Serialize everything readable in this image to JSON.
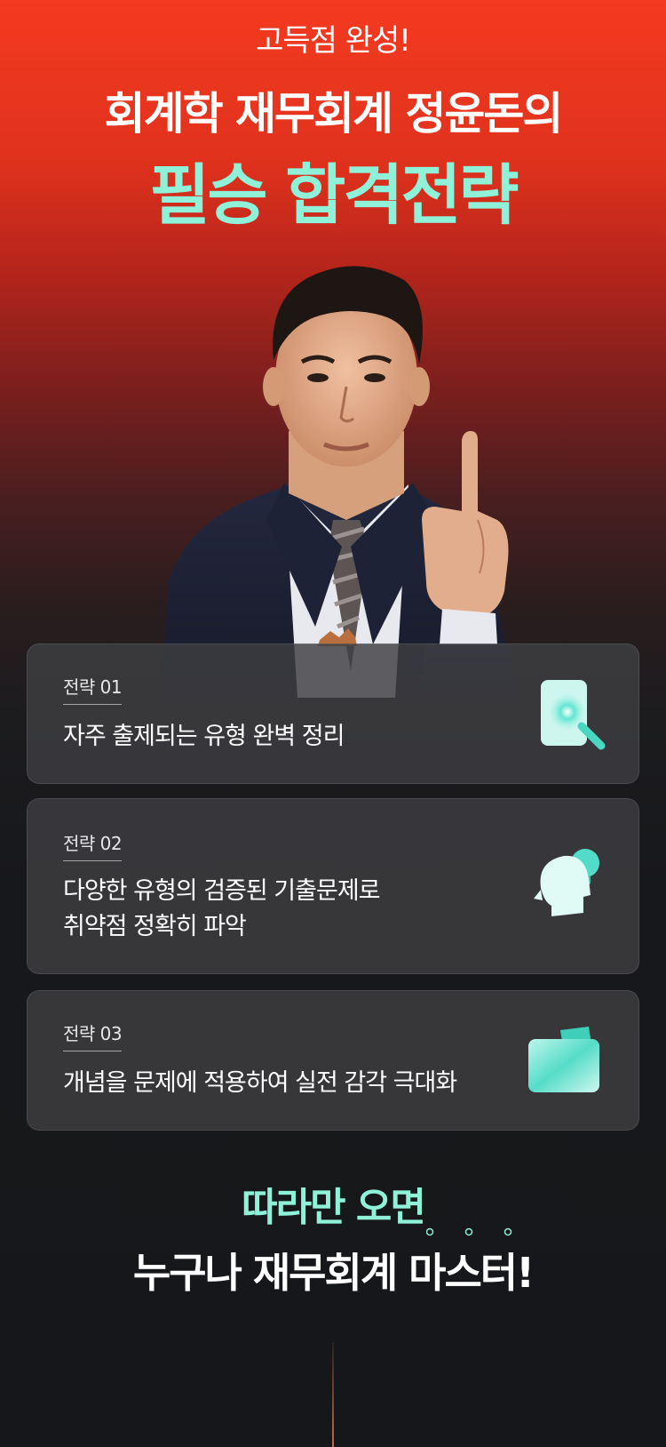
{
  "header": {
    "subtitle": "고득점 완성!",
    "title": "회계학 재무회계 정윤돈의",
    "highlight": "필승 합격전략"
  },
  "strategies": [
    {
      "label": "전략 01",
      "lines": [
        "자주 출제되는 유형 완벽 정리"
      ],
      "icon": "magnifier-icon"
    },
    {
      "label": "전략 02",
      "lines": [
        "다양한 유형의 검증된 기출문제로",
        "취약점 정확히 파악"
      ],
      "icon": "head-lightbulb-icon"
    },
    {
      "label": "전략 03",
      "lines": [
        "개념을 문제에 적용하여 실전 감각 극대화"
      ],
      "icon": "folder-icon"
    }
  ],
  "footer": {
    "line1": "따라만 오면",
    "line2": "누구나 재무회계 마스터!"
  },
  "colors": {
    "accent": "#8ef1d8",
    "top_red": "#f43a20",
    "dark_bg": "#17181b"
  }
}
